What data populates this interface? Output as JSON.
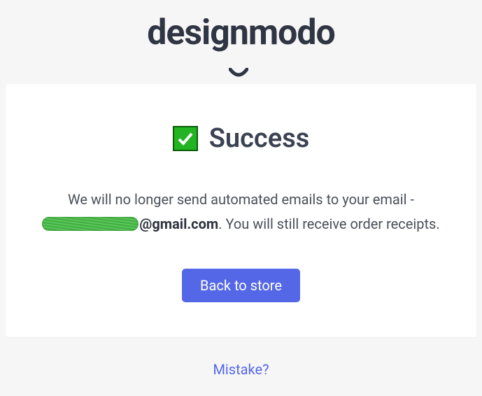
{
  "brand": {
    "name": "designmodo"
  },
  "card": {
    "title": "Success",
    "message_pre": "We will no longer send automated emails to your email -",
    "email_redacted": true,
    "email_visible": "@gmail.com",
    "message_post": ". You will still receive order receipts.",
    "button_label": "Back to store"
  },
  "footer": {
    "mistake_label": "Mistake?"
  },
  "icons": {
    "success": "check-icon"
  },
  "colors": {
    "accent": "#5468e7",
    "success": "#22b422",
    "text": "#3b4251"
  }
}
